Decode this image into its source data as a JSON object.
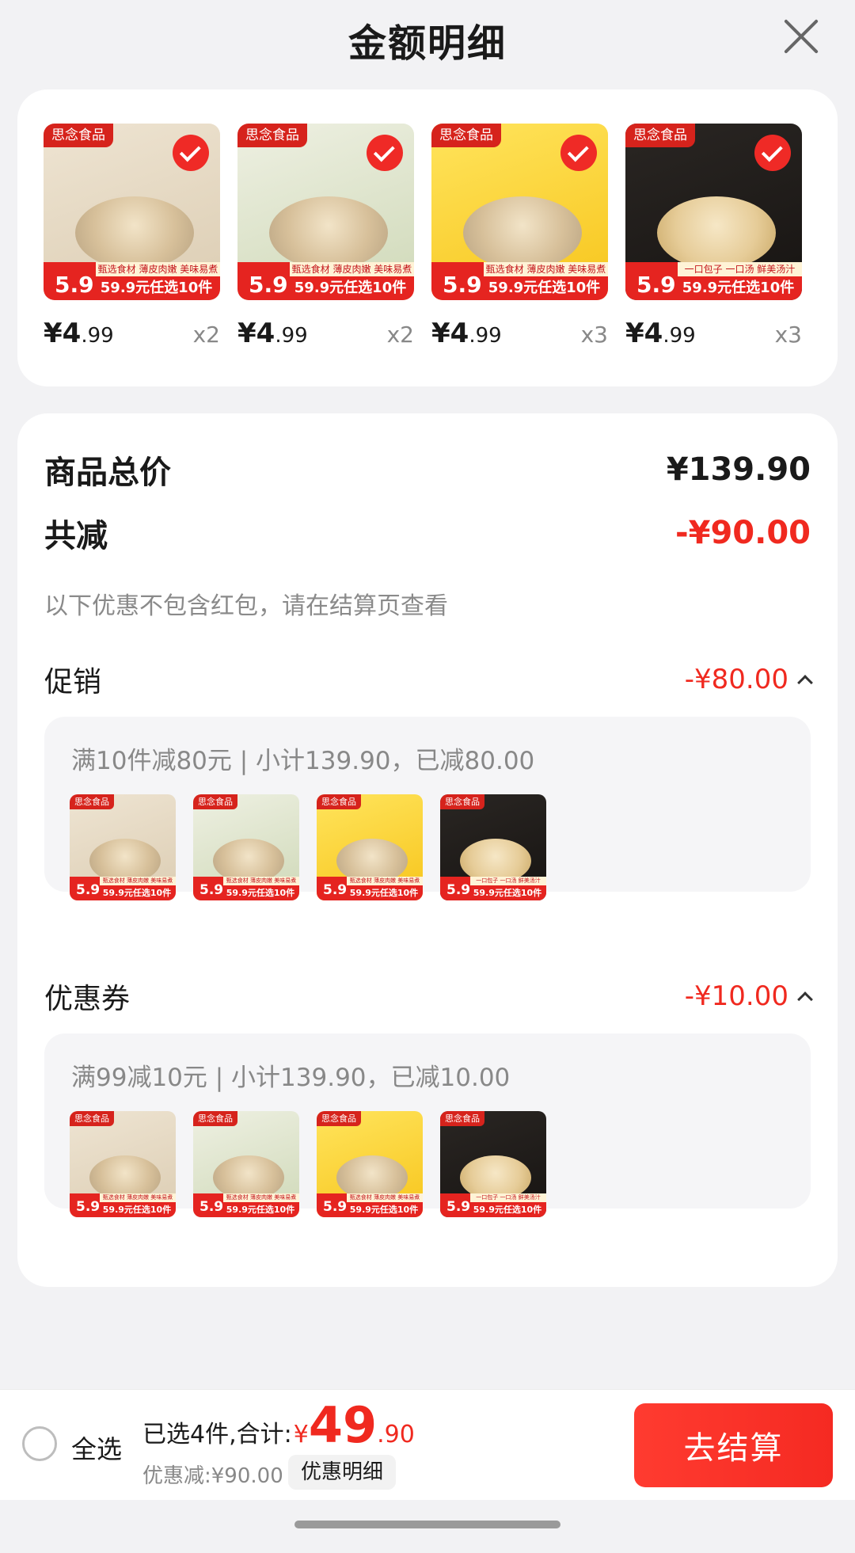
{
  "header": {
    "title": "金额明细"
  },
  "products": [
    {
      "brand": "思念食品",
      "variant": "beige",
      "tag": "甄选食材 薄皮肉嫩 美味易煮",
      "big": "5.9",
      "promo": "59.9元任选10件",
      "price_int": "¥4",
      "price_dec": ".99",
      "qty": "x2"
    },
    {
      "brand": "思念食品",
      "variant": "green",
      "tag": "甄选食材 薄皮肉嫩 美味易煮",
      "big": "5.9",
      "promo": "59.9元任选10件",
      "price_int": "¥4",
      "price_dec": ".99",
      "qty": "x2"
    },
    {
      "brand": "思念食品",
      "variant": "yellow",
      "tag": "甄选食材 薄皮肉嫩 美味易煮",
      "big": "5.9",
      "promo": "59.9元任选10件",
      "price_int": "¥4",
      "price_dec": ".99",
      "qty": "x3"
    },
    {
      "brand": "思念食品",
      "variant": "dark",
      "tag": "一口包子 一口汤 鲜美汤汁",
      "big": "5.9",
      "promo": "59.9元任选10件",
      "price_int": "¥4",
      "price_dec": ".99",
      "qty": "x3"
    }
  ],
  "summary": {
    "total_label": "商品总价",
    "total_value": "¥139.90",
    "reduce_label": "共减",
    "reduce_value": "-¥90.00",
    "note": "以下优惠不包含红包，请在结算页查看"
  },
  "promotion": {
    "label": "促销",
    "value": "-¥80.00",
    "sub_title": "满10件减80元 | 小计139.90，已减80.00"
  },
  "coupon": {
    "label": "优惠券",
    "value": "-¥10.00",
    "sub_title": "满99减10元 | 小计139.90，已减10.00"
  },
  "bottom": {
    "select_all": "全选",
    "selected_text": "已选4件,合计:",
    "yen": "¥",
    "total_int": "49",
    "total_dec": ".90",
    "discount": "优惠减:¥90.00",
    "detail_button": "优惠明细",
    "checkout_button": "去结算"
  },
  "colors": {
    "accent": "#f0291f",
    "background": "#f2f2f4"
  }
}
